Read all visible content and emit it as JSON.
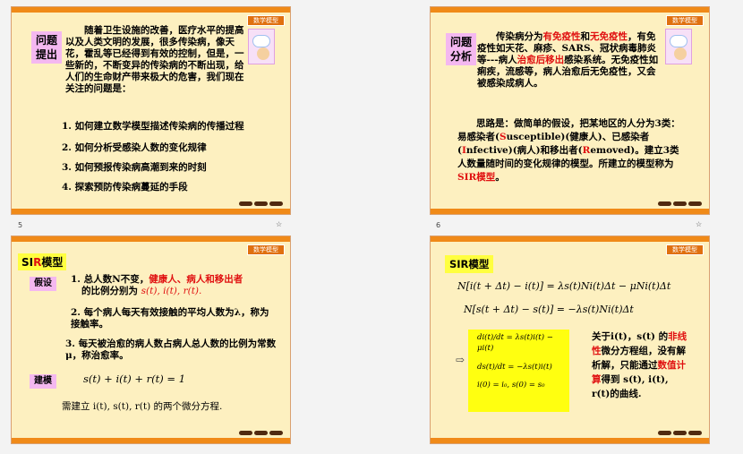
{
  "tag_label": "数学模型",
  "slides": [
    {
      "number": "5",
      "label": "问题\n提出",
      "intro": "随着卫生设施的改善，医疗水平的提高以及人类文明的发展，很多传染病，像天花，霍乱等已经得到有效的控制，但是，一些新的，不断变异的传染病的不断出现，给人们的生命财产带来极大的危害，我们现在关注的问题是：",
      "items": [
        "1. 如何建立数学模型描述传染病的传播过程",
        "2. 如何分析受感染人数的变化规律",
        "3. 如何预报传染病高潮到来的时刻",
        "4. 探索预防传染病蔓延的手段"
      ]
    },
    {
      "number": "6",
      "label": "问题\n分析",
      "p1_a": "传染病分为",
      "p1_b": "有免疫性",
      "p1_c": "和",
      "p1_d": "无免疫性",
      "p1_e": "，有免疫性如天花、麻疹、SARS、冠状病毒肺炎等---病人",
      "p1_f": "治愈后移出",
      "p1_g": "感染系统。无免疫性如痢疾，流感等，病人治愈后无免疫性，又会被感染成病人。",
      "p2_a": "思路是：做简单的假设，把某地区的人分为3类：易感染者(",
      "p2_s": "S",
      "p2_b": "usceptible)(健康人)、已感染者 (",
      "p2_i": "I",
      "p2_c": "nfective)(病人)和移出者(",
      "p2_r": "R",
      "p2_d": "emoved)。建立3类人数量随时间的变化规律的模型。所建立的模型称为",
      "p2_e": "SIR模型",
      "p2_f": "。"
    },
    {
      "number": "7",
      "title_a": "SI",
      "title_b": "R",
      "title_c": "模型",
      "assume_label": "假设",
      "a1_a": "1. 总人数N不变，",
      "a1_b": "健康人、病人和移出者",
      "a1_c": "的比例分别为",
      "a1_d": "s(t), i(t), r(t).",
      "a2": "2. 每个病人每天有效接触的平均人数为λ，称为接触率。",
      "a3": "3. 每天被治愈的病人数占病人总人数的比例为常数 μ，称治愈率。",
      "build_label": "建模",
      "eq": "s(t) + i(t) + r(t) = 1",
      "need": "需建立 i(t), s(t), r(t) 的两个微分方程."
    },
    {
      "number": "8",
      "title": "SIR模型",
      "eq1": "N[i(t + Δt) − i(t)] = λs(t)Ni(t)Δt − μNi(t)Δt",
      "eq2": "N[s(t + Δt) − s(t)] = −λs(t)Ni(t)Δt",
      "sys1": "di(t)/dt = λs(t)i(t) − μi(t)",
      "sys2": "ds(t)/dt = −λs(t)i(t)",
      "sys3": "i(0) = i₀, s(0) = s₀",
      "note_a": "关于i(t)，s(t) 的",
      "note_b": "非线性",
      "note_c": "微分方程组，没有解析解，只能通过",
      "note_d": "数值计算",
      "note_e": "得到 s(t), i(t), r(t)的曲线."
    }
  ]
}
